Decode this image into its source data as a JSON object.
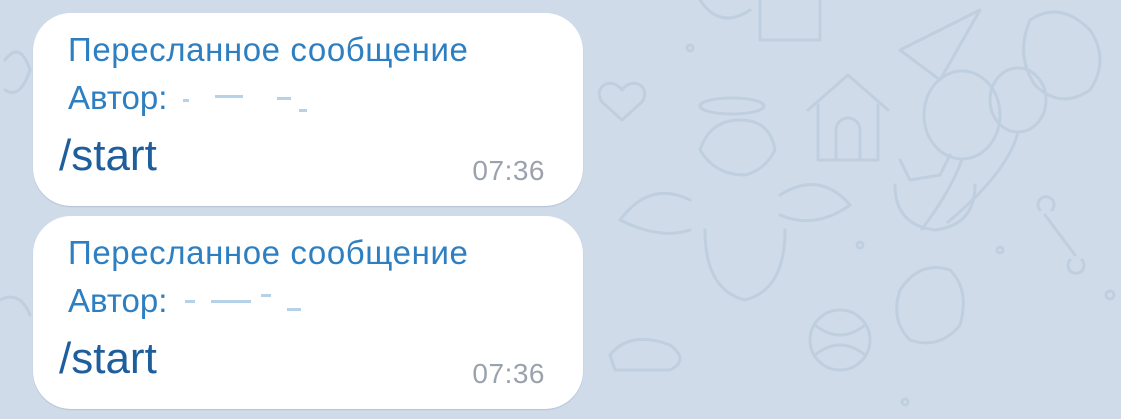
{
  "messages": [
    {
      "forward_header": "Пересланное сообщение",
      "author_label": "Автор:",
      "text": "/start",
      "time": "07:36"
    },
    {
      "forward_header": "Пересланное сообщение",
      "author_label": "Автор:",
      "text": "/start",
      "time": "07:36"
    }
  ],
  "colors": {
    "wallpaper": "#cfdbe8",
    "bubble": "#ffffff",
    "link_blue": "#2e7fc1",
    "message_text": "#1e5e9c",
    "timestamp": "#9aa3ad"
  },
  "icons": [
    "doodle-wallpaper-pattern"
  ]
}
